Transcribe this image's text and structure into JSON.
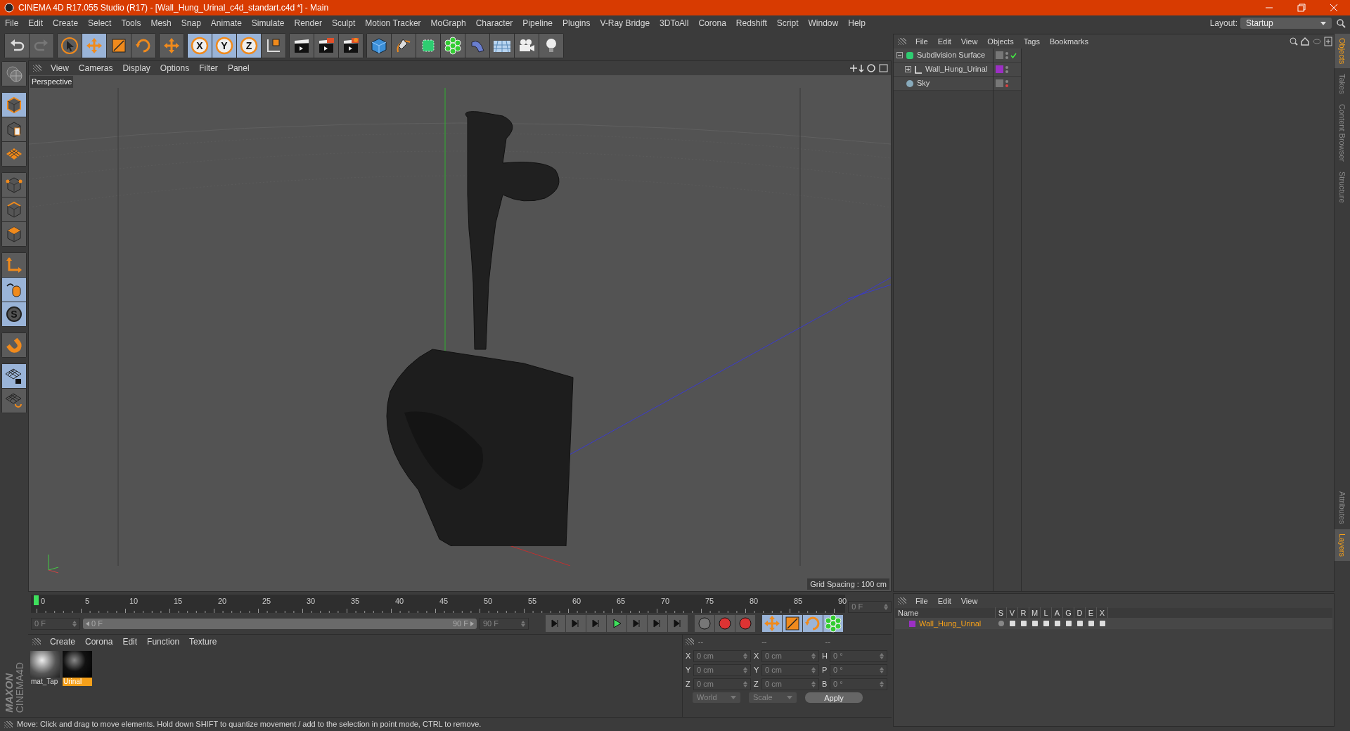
{
  "window": {
    "title": "CINEMA 4D R17.055 Studio (R17) - [Wall_Hung_Urinal_c4d_standart.c4d *] - Main"
  },
  "menu": [
    "File",
    "Edit",
    "Create",
    "Select",
    "Tools",
    "Mesh",
    "Snap",
    "Animate",
    "Simulate",
    "Render",
    "Sculpt",
    "Motion Tracker",
    "MoGraph",
    "Character",
    "Pipeline",
    "Plugins",
    "V-Ray Bridge",
    "3DToAll",
    "Corona",
    "Redshift",
    "Script",
    "Window",
    "Help"
  ],
  "layout": {
    "label": "Layout:",
    "value": "Startup"
  },
  "toolbar": [
    [
      {
        "kind": "undo",
        "selected": false
      },
      {
        "kind": "redo",
        "selected": false
      }
    ],
    [
      {
        "kind": "select",
        "selected": false
      },
      {
        "kind": "move",
        "selected": true
      },
      {
        "kind": "scale",
        "selected": false
      },
      {
        "kind": "rotate",
        "selected": false
      }
    ],
    [
      {
        "kind": "move",
        "selected": false
      }
    ],
    [
      {
        "kind": "axis",
        "label": "X",
        "selected": true
      },
      {
        "kind": "axis",
        "label": "Y",
        "selected": true
      },
      {
        "kind": "axis",
        "label": "Z",
        "selected": true
      },
      {
        "kind": "coords",
        "selected": false
      }
    ],
    [
      {
        "kind": "render-view",
        "selected": false
      },
      {
        "kind": "render",
        "selected": false
      },
      {
        "kind": "render-settings",
        "selected": false
      }
    ],
    [
      {
        "kind": "cube",
        "selected": false
      },
      {
        "kind": "pen",
        "selected": false
      },
      {
        "kind": "subdivision",
        "selected": false
      },
      {
        "kind": "cloner",
        "selected": false
      },
      {
        "kind": "deformer",
        "selected": false
      },
      {
        "kind": "floor",
        "selected": false
      },
      {
        "kind": "camera",
        "selected": false
      },
      {
        "kind": "light",
        "selected": false
      }
    ]
  ],
  "left_tools": [
    [
      {
        "kind": "globe",
        "selected": false
      }
    ],
    [
      {
        "kind": "model",
        "selected": true
      },
      {
        "kind": "texture",
        "selected": false
      },
      {
        "kind": "workplane",
        "selected": false
      }
    ],
    [
      {
        "kind": "points",
        "selected": false
      },
      {
        "kind": "edges",
        "selected": false
      },
      {
        "kind": "polygons",
        "selected": false
      }
    ],
    [
      {
        "kind": "axis",
        "selected": false
      },
      {
        "kind": "tweak",
        "selected": true
      },
      {
        "kind": "snap",
        "label": "S",
        "selected": true
      }
    ],
    [
      {
        "kind": "magnet",
        "selected": false
      }
    ],
    [
      {
        "kind": "lock",
        "selected": true
      },
      {
        "kind": "grid-rotate",
        "selected": false
      }
    ]
  ],
  "logo": {
    "top": "MAXON",
    "bottom": "CINEMA4D"
  },
  "viewport": {
    "menu": [
      "View",
      "Cameras",
      "Display",
      "Options",
      "Filter",
      "Panel"
    ],
    "label": "Perspective",
    "grid_spacing": "Grid Spacing : 100 cm"
  },
  "objects_panel": {
    "menu": [
      "File",
      "Edit",
      "View",
      "Objects",
      "Tags",
      "Bookmarks"
    ],
    "tree": [
      {
        "name": "Subdivision Surface",
        "kind": "subdivision",
        "expanded": true,
        "checked": true,
        "render_visible": true,
        "children": [
          {
            "name": "Wall_Hung_Urinal",
            "kind": "null",
            "expanded": false,
            "checked": false,
            "render_visible": true,
            "color": "#9c2fc4"
          }
        ]
      },
      {
        "name": "Sky",
        "kind": "sky",
        "checked": false,
        "render_visible": false
      }
    ]
  },
  "timeline": {
    "ticks": [
      "0",
      "5",
      "10",
      "15",
      "20",
      "25",
      "30",
      "35",
      "40",
      "45",
      "50",
      "55",
      "60",
      "65",
      "70",
      "75",
      "80",
      "85",
      "90"
    ],
    "playhead": {
      "level": 0
    },
    "range": {
      "level": 1
    },
    "current": "0 F",
    "start": "0 F",
    "range_start": "0 F",
    "range_end": "90 F",
    "end": "90 F"
  },
  "materials": {
    "menu": [
      "Create",
      "Corona",
      "Edit",
      "Function",
      "Texture"
    ],
    "items": [
      {
        "name": "mat_Tap",
        "kind": "chrome",
        "selected": false
      },
      {
        "name": "Urinal",
        "kind": "black",
        "selected": true
      }
    ]
  },
  "coordinates": {
    "headers": [
      "--",
      "--",
      "--"
    ],
    "rows": [
      [
        {
          "axis": "X",
          "value": "0 cm"
        },
        {
          "axis": "X",
          "value": "0 cm"
        },
        {
          "axis": "H",
          "value": "0 °"
        }
      ],
      [
        {
          "axis": "Y",
          "value": "0 cm"
        },
        {
          "axis": "Y",
          "value": "0 cm"
        },
        {
          "axis": "P",
          "value": "0 °"
        }
      ],
      [
        {
          "axis": "Z",
          "value": "0 cm"
        },
        {
          "axis": "Z",
          "value": "0 cm"
        },
        {
          "axis": "B",
          "value": "0 °"
        }
      ]
    ],
    "dropdowns": [
      "World",
      "Scale"
    ],
    "apply": "Apply"
  },
  "layers_panel": {
    "menu": [
      "File",
      "Edit",
      "View"
    ],
    "columns": [
      "Name",
      "S",
      "V",
      "R",
      "M",
      "L",
      "A",
      "G",
      "D",
      "E",
      "X"
    ],
    "rows": [
      {
        "name": "Wall_Hung_Urinal",
        "color": "#9c2fc4"
      }
    ]
  },
  "side_tabs_top": [
    {
      "label": "Objects",
      "selected": true
    },
    {
      "label": "Takes",
      "selected": false
    },
    {
      "label": "Content Browser",
      "selected": false
    },
    {
      "label": "Structure",
      "selected": false
    }
  ],
  "side_tabs_bottom": [
    {
      "label": "Attributes",
      "selected": false
    },
    {
      "label": "Layers",
      "selected": true
    }
  ],
  "status_bar": "Move: Click and drag to move elements. Hold down SHIFT to quantize movement / add to the selection in point mode, CTRL to remove."
}
